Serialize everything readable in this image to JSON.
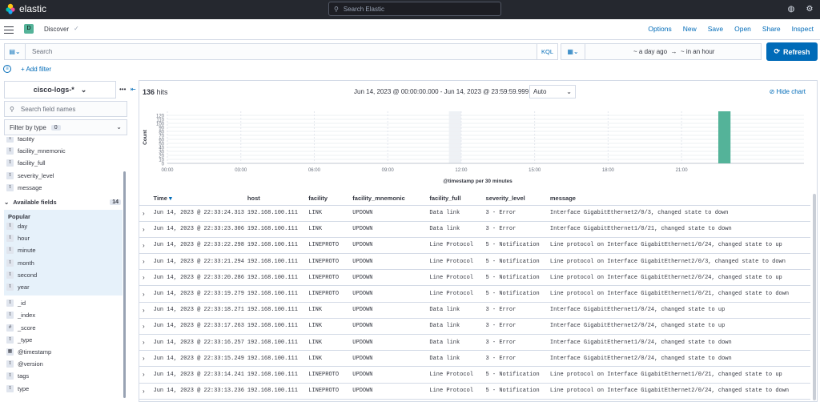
{
  "topbar": {
    "brand": "elastic",
    "search_placeholder": "Search Elastic"
  },
  "appbar": {
    "badge": "D",
    "title": "Discover",
    "nav": [
      "Options",
      "New",
      "Save",
      "Open",
      "Share",
      "Inspect"
    ]
  },
  "querybar": {
    "placeholder": "Search",
    "language": "KQL",
    "start": "~ a day ago",
    "arrow": "→",
    "end": "~ in an hour",
    "refresh_label": "Refresh"
  },
  "filters": {
    "add_label": "+ Add filter"
  },
  "sidebar": {
    "index_pattern": "cisco-logs-*",
    "field_search_placeholder": "Search field names",
    "filter_by_type": "Filter by type",
    "filter_count": "0",
    "selected_fields": [
      {
        "type": "t",
        "name": "facility"
      },
      {
        "type": "t",
        "name": "facility_mnemonic"
      },
      {
        "type": "t",
        "name": "facility_full"
      },
      {
        "type": "t",
        "name": "severity_level"
      },
      {
        "type": "t",
        "name": "message"
      }
    ],
    "available_label": "Available fields",
    "available_count": "14",
    "popular_label": "Popular",
    "popular_fields": [
      {
        "type": "t",
        "name": "day"
      },
      {
        "type": "t",
        "name": "hour"
      },
      {
        "type": "t",
        "name": "minute"
      },
      {
        "type": "t",
        "name": "month"
      },
      {
        "type": "t",
        "name": "second"
      },
      {
        "type": "t",
        "name": "year"
      }
    ],
    "other_fields": [
      {
        "type": "t",
        "name": "_id"
      },
      {
        "type": "t",
        "name": "_index"
      },
      {
        "type": "#",
        "name": "_score"
      },
      {
        "type": "t",
        "name": "_type"
      },
      {
        "type": "▦",
        "name": "@timestamp"
      },
      {
        "type": "t",
        "name": "@version"
      },
      {
        "type": "t",
        "name": "tags"
      },
      {
        "type": "t",
        "name": "type"
      }
    ]
  },
  "results": {
    "hits_count": "136",
    "hits_label": "hits",
    "time_range": "Jun 14, 2023 @ 00:00:00.000 - Jun 14, 2023 @ 23:59:59.999",
    "interval": "Auto",
    "hide_chart": "Hide chart"
  },
  "chart_data": {
    "type": "bar",
    "title": "",
    "xlabel": "@timestamp per 30 minutes",
    "ylabel": "Count",
    "ylim": [
      0,
      130
    ],
    "yticks": [
      0,
      10,
      20,
      30,
      40,
      50,
      60,
      70,
      80,
      90,
      100,
      110,
      120
    ],
    "xticks": [
      "00:00",
      "03:00",
      "06:00",
      "09:00",
      "12:00",
      "15:00",
      "18:00",
      "21:00"
    ],
    "x_range_hours": [
      0,
      26
    ],
    "series": [
      {
        "values": [
          {
            "hour": 22.5,
            "count": 136
          }
        ]
      }
    ],
    "colors": {
      "bar": "#54b399",
      "highlight_band": "#eef1f5"
    },
    "grid": true
  },
  "table": {
    "columns": [
      "Time",
      "host",
      "facility",
      "facility_mnemonic",
      "facility_full",
      "severity_level",
      "message"
    ],
    "rows": [
      [
        "Jun 14, 2023 @ 22:33:24.313",
        "192.168.100.111",
        "LINK",
        "UPDOWN",
        "Data link",
        "3 - Error",
        "Interface GigabitEthernet2/0/3, changed state to down"
      ],
      [
        "Jun 14, 2023 @ 22:33:23.306",
        "192.168.100.111",
        "LINK",
        "UPDOWN",
        "Data link",
        "3 - Error",
        "Interface GigabitEthernet1/0/21, changed state to down"
      ],
      [
        "Jun 14, 2023 @ 22:33:22.298",
        "192.168.100.111",
        "LINEPROTO",
        "UPDOWN",
        "Line Protocol",
        "5 - Notification",
        "Line protocol on Interface GigabitEthernet1/0/24, changed state to up"
      ],
      [
        "Jun 14, 2023 @ 22:33:21.294",
        "192.168.100.111",
        "LINEPROTO",
        "UPDOWN",
        "Line Protocol",
        "5 - Notification",
        "Line protocol on Interface GigabitEthernet2/0/3, changed state to down"
      ],
      [
        "Jun 14, 2023 @ 22:33:20.286",
        "192.168.100.111",
        "LINEPROTO",
        "UPDOWN",
        "Line Protocol",
        "5 - Notification",
        "Line protocol on Interface GigabitEthernet2/0/24, changed state to up"
      ],
      [
        "Jun 14, 2023 @ 22:33:19.279",
        "192.168.100.111",
        "LINEPROTO",
        "UPDOWN",
        "Line Protocol",
        "5 - Notification",
        "Line protocol on Interface GigabitEthernet1/0/21, changed state to down"
      ],
      [
        "Jun 14, 2023 @ 22:33:18.271",
        "192.168.100.111",
        "LINK",
        "UPDOWN",
        "Data link",
        "3 - Error",
        "Interface GigabitEthernet1/0/24, changed state to up"
      ],
      [
        "Jun 14, 2023 @ 22:33:17.263",
        "192.168.100.111",
        "LINK",
        "UPDOWN",
        "Data link",
        "3 - Error",
        "Interface GigabitEthernet2/0/24, changed state to up"
      ],
      [
        "Jun 14, 2023 @ 22:33:16.257",
        "192.168.100.111",
        "LINK",
        "UPDOWN",
        "Data link",
        "3 - Error",
        "Interface GigabitEthernet1/0/24, changed state to down"
      ],
      [
        "Jun 14, 2023 @ 22:33:15.249",
        "192.168.100.111",
        "LINK",
        "UPDOWN",
        "Data link",
        "3 - Error",
        "Interface GigabitEthernet2/0/24, changed state to down"
      ],
      [
        "Jun 14, 2023 @ 22:33:14.241",
        "192.168.100.111",
        "LINEPROTO",
        "UPDOWN",
        "Line Protocol",
        "5 - Notification",
        "Line protocol on Interface GigabitEthernet1/0/21, changed state to up"
      ],
      [
        "Jun 14, 2023 @ 22:33:13.236",
        "192.168.100.111",
        "LINEPROTO",
        "UPDOWN",
        "Line Protocol",
        "5 - Notification",
        "Line protocol on Interface GigabitEthernet2/0/24, changed state to down"
      ]
    ]
  }
}
